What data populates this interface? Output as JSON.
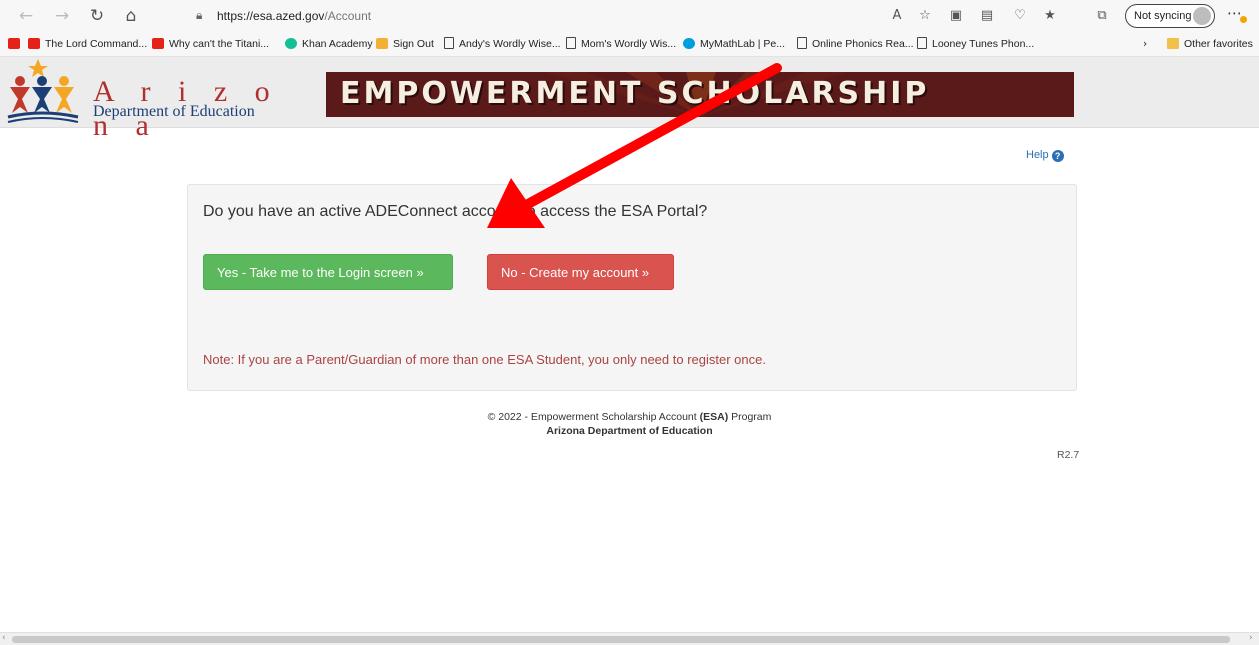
{
  "browser": {
    "url_host": "https://esa.azed.gov",
    "url_path": "/Account",
    "sync_label": "Not syncing",
    "icons": [
      "back-icon",
      "forward-icon",
      "refresh-icon",
      "home-icon",
      "lock-icon",
      "read-aloud-icon",
      "add-favorite-icon",
      "extension-icon",
      "collections-icon",
      "browser-essentials-icon",
      "favorites-icon",
      "copilot-icon"
    ]
  },
  "favorites": {
    "items": [
      {
        "label": "",
        "icon": "youtube-icon"
      },
      {
        "label": "The Lord Command...",
        "icon": "youtube-icon"
      },
      {
        "label": "Why can't the Titani...",
        "icon": "youtube-icon"
      },
      {
        "label": "Khan Academy",
        "icon": "khan-academy-icon"
      },
      {
        "label": "Sign Out",
        "icon": "signout-icon"
      },
      {
        "label": "Andy's Wordly Wise...",
        "icon": "link-icon"
      },
      {
        "label": "Mom's Wordly Wis...",
        "icon": "page-icon"
      },
      {
        "label": "MyMathLab | Pe...",
        "icon": "pearson-icon"
      },
      {
        "label": "Online Phonics Rea...",
        "icon": "page-icon"
      },
      {
        "label": "Looney Tunes Phon...",
        "icon": "page-icon"
      }
    ],
    "other_label": "Other favorites"
  },
  "header": {
    "logo_word": "A r i z o n a",
    "logo_dept": "Department of Education",
    "banner": "EMPOWERMENT SCHOLARSHIP"
  },
  "content": {
    "help_label": "Help",
    "question": "Do you have an active ADEConnect account to access the ESA Portal?",
    "yes_button": "Yes - Take me to the Login screen »",
    "no_button": "No - Create my account »",
    "note": "Note: If you are a Parent/Guardian of more than one ESA Student, you only need to register once."
  },
  "footer": {
    "line1_prefix": "© 2022 - Empowerment Scholarship Account ",
    "line1_bold": "(ESA)",
    "line1_suffix": " Program",
    "line2": "Arizona Department of Education",
    "version": "R2.7"
  },
  "colors": {
    "yes_button": "#5cb85c",
    "no_button": "#d9534f",
    "note_text": "#a94442",
    "banner_bg": "#5a1a1a",
    "annotation_arrow": "#ff0000"
  }
}
